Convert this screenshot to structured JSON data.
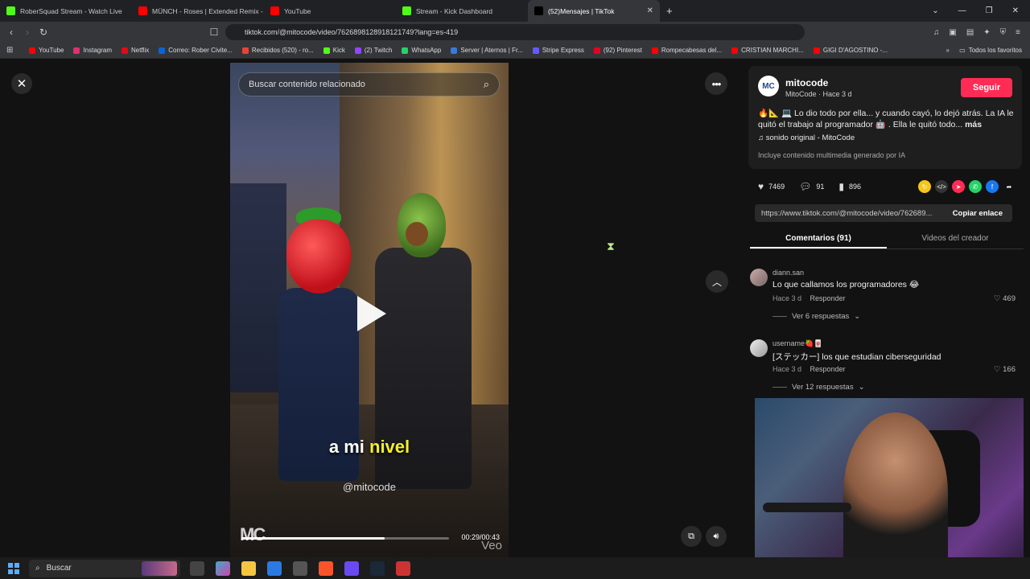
{
  "tabs": [
    {
      "label": "RoberSquad Stream - Watch Live",
      "icon": "kick-icon",
      "color": "#53fc18"
    },
    {
      "label": "MÜNCH - Roses | Extended Remix - YouTube",
      "icon": "youtube-icon",
      "color": "#ff0000"
    },
    {
      "label": "YouTube",
      "icon": "youtube-icon",
      "color": "#ff0000"
    },
    {
      "label": "Stream - Kick Dashboard",
      "icon": "kick-icon",
      "color": "#53fc18"
    },
    {
      "label": "(52)Mensajes | TikTok",
      "icon": "tiktok-icon",
      "color": "#000000",
      "active": true
    }
  ],
  "address": {
    "url": "tiktok.com/@mitocode/video/7626898128918121749?lang=es-419"
  },
  "bookmarks": [
    {
      "label": "YouTube",
      "color": "#ff0000"
    },
    {
      "label": "Instagram",
      "color": "#e1306c"
    },
    {
      "label": "Netflix",
      "color": "#e50914"
    },
    {
      "label": "Correo: Rober Civite...",
      "color": "#0a64d6"
    },
    {
      "label": "Recibidos (520) - ro...",
      "color": "#ea4335"
    },
    {
      "label": "Kick",
      "color": "#53fc18"
    },
    {
      "label": "(2) Twitch",
      "color": "#9146ff"
    },
    {
      "label": "WhatsApp",
      "color": "#25d366"
    },
    {
      "label": "Server | Aternos | Fr...",
      "color": "#3a7ad6"
    },
    {
      "label": "Stripe Express",
      "color": "#635bff"
    },
    {
      "label": "(92) Pinterest",
      "color": "#e60023"
    },
    {
      "label": "Rompecabesas del...",
      "color": "#ff0000"
    },
    {
      "label": "CRISTIAN MARCHI...",
      "color": "#ff0000"
    },
    {
      "label": "GIGI D'AGOSTINO -...",
      "color": "#ff0000"
    }
  ],
  "bookmarks_all": "Todos los favoritos",
  "video": {
    "search_placeholder": "Buscar contenido relacionado",
    "caption_pre": "a mi",
    "caption_hl": "nivel",
    "watermark": "@mitocode",
    "logo": "MC",
    "veo": "Veo",
    "time": "00:29/00:43",
    "progress": 0.69
  },
  "author": {
    "avatar": "MC",
    "name": "mitocode",
    "sub": "MitoCode · Hace 3 d",
    "follow": "Seguir",
    "description": "🔥📐 💻 Lo dio todo por ella... y cuando cayó, lo dejó atrás. La IA le quitó el trabajo al programador 🤖 . Ella le quitó todo...",
    "more": "más",
    "music": "♫  sonido original - MitoCode",
    "ai_label": "Incluye contenido multimedia generado por IA"
  },
  "stats": {
    "likes": "7469",
    "comments": "91",
    "saves": "896"
  },
  "link": {
    "url": "https://www.tiktok.com/@mitocode/video/762689...",
    "copy": "Copiar enlace"
  },
  "panel_tabs": [
    {
      "label": "Comentarios (91)",
      "active": true
    },
    {
      "label": "Videos del creador",
      "active": false
    }
  ],
  "comments": [
    {
      "user": "diann.san",
      "text": "Lo que callamos los programadores 😂",
      "time": "Hace 3 d",
      "reply": "Responder",
      "likes": "469",
      "replies": "Ver 6 respuestas"
    },
    {
      "user": "username🍓🀄",
      "text": "[ステッカー] los que estudian ciberseguridad",
      "time": "Hace 3 d",
      "reply": "Responder",
      "likes": "166",
      "replies": "Ver 12 respuestas"
    }
  ],
  "taskbar": {
    "search": "Buscar"
  }
}
